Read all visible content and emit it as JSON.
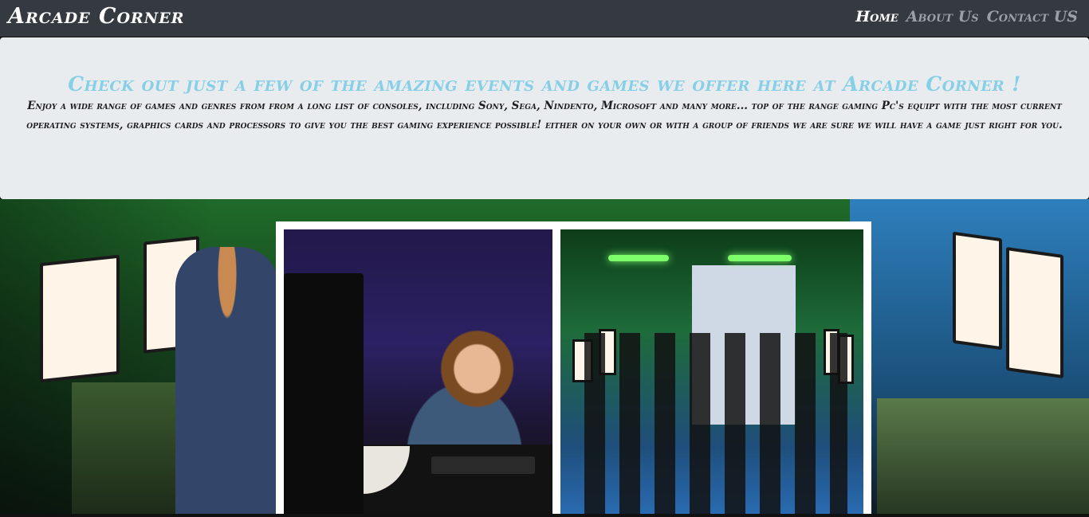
{
  "navbar": {
    "brand": "Arcade Corner",
    "links": [
      {
        "label": "Home",
        "active": true
      },
      {
        "label": "About Us",
        "active": false
      },
      {
        "label": "Contact US",
        "active": false
      }
    ]
  },
  "jumbotron": {
    "heading": "Check out just a few of the amazing events and games we offer here at Arcade Corner !",
    "paragraph": "Enjoy a wide range of games and genres from from a long list of consoles, including Sony, Sega, Nindento, Microsoft and many more... top of the range gaming Pc's equipt with the most current operating systems, graphics cards and processors to give you the best gaming experience possible! either on your own or with a group of friends we are sure we will have a game just right for you."
  },
  "colors": {
    "navbar_bg": "#343a40",
    "jumbotron_bg": "#e9ecef",
    "heading": "#86cfe6",
    "nav_inactive": "#9aa0a6"
  }
}
